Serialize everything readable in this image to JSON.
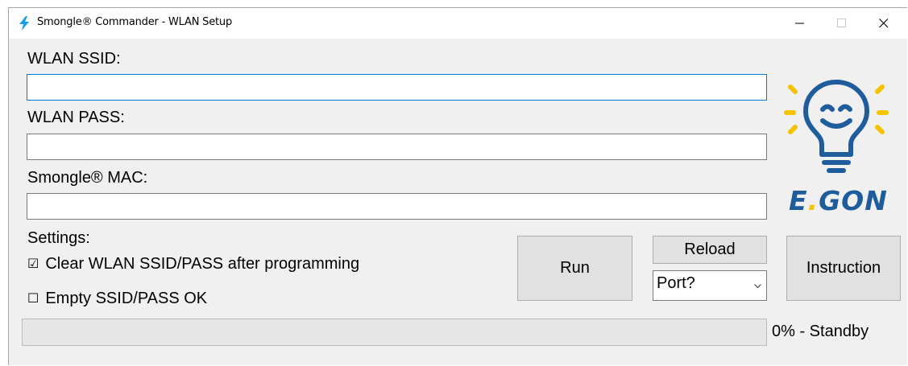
{
  "window": {
    "title": "Smongle® Commander - WLAN Setup",
    "controls": [
      "minimize-icon",
      "maximize-icon",
      "close-icon"
    ]
  },
  "form": {
    "ssid_label": "WLAN SSID:",
    "ssid_value": "",
    "pass_label": "WLAN PASS:",
    "pass_value": "",
    "mac_label": "Smongle® MAC:",
    "mac_value": ""
  },
  "settings": {
    "label": "Settings:",
    "options": [
      {
        "label": "Clear WLAN SSID/PASS after programming",
        "checked": true,
        "glyph": "☑"
      },
      {
        "label": "Empty SSID/PASS OK",
        "checked": false,
        "glyph": "☐"
      }
    ]
  },
  "actions": {
    "run_label": "Run",
    "reload_label": "Reload",
    "port_selected": "Port?",
    "instruction_label": "Instruction"
  },
  "progress": {
    "value": 0,
    "status": "0% - Standby"
  },
  "logo": {
    "text_e": "E",
    "text_dot": ".",
    "text_gon": "GON",
    "icon": "smiling-lightbulb-icon"
  },
  "colors": {
    "accent": "#0078d7",
    "brand_blue": "#1e5c9c",
    "brand_yellow": "#f5c400",
    "window_bg": "#f0f0f0"
  }
}
